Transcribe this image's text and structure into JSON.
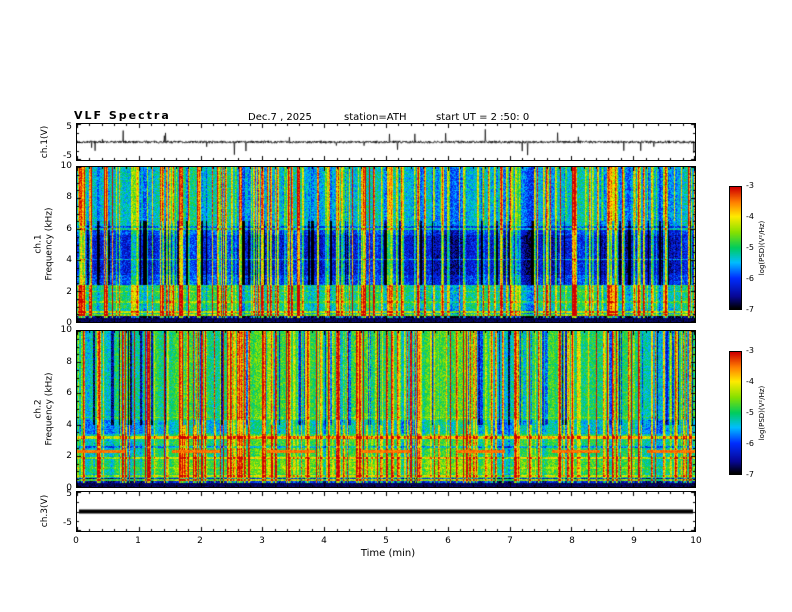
{
  "header": {
    "title": "VLF  Spectra",
    "date": "Dec.7  , 2025",
    "station": "station=ATH",
    "start_ut": "start UT =  2 :50: 0"
  },
  "x_axis": {
    "label": "Time (min)",
    "range": [
      0,
      10
    ],
    "tick_labels": [
      "0",
      "1",
      "2",
      "3",
      "4",
      "5",
      "6",
      "7",
      "8",
      "9",
      "10"
    ]
  },
  "chart_data": [
    {
      "type": "line",
      "name": "ch.1 voltage waveform",
      "ylabel": "ch.1(V)",
      "ylim": [
        -5,
        5
      ],
      "ytick_labels": [
        "5",
        "-5"
      ],
      "xlim": [
        0,
        10
      ],
      "summary": "Noisy broadband trace hovering near 0 V for 10 minutes with frequent impulsive sferic spikes reaching roughly +/-4 V.",
      "render": {
        "seed": 7,
        "noise_amp": 0.38,
        "spike_rate": 0.018,
        "spike_amp": 2.8
      }
    },
    {
      "type": "heatmap",
      "name": "ch.1 spectrogram",
      "channel": "ch.1",
      "ylabel": "Frequency (kHz)",
      "ylim": [
        0,
        10
      ],
      "ytick_labels": [
        "10",
        "8",
        "6",
        "4",
        "2",
        "0"
      ],
      "xlim": [
        0,
        10
      ],
      "colorbar": {
        "label": "log(PSD)(V²/Hz)",
        "tick_labels": [
          "-3",
          "-4",
          "-5",
          "-6",
          "-7"
        ],
        "vmin": -7,
        "vmax": -3
      },
      "summary": "Dense vertical sferic streaks over a green/cyan background; darker blue band near 3-6 kHz; bright yellow horizontal lines below 2.5 kHz; black band at 0-0.25 kHz.",
      "render": {
        "seed": 11,
        "base": -5.15,
        "noise": 0.85,
        "streak_density": 0.33,
        "dark_density": 0.1,
        "bands": [
          [
            0.25,
            0.5,
            -6.6
          ],
          [
            0.8,
            2.4,
            -5.0
          ],
          [
            2.4,
            6.2,
            -5.9
          ],
          [
            3.0,
            5.6,
            -6.15
          ],
          [
            6.2,
            10,
            -5.3
          ]
        ],
        "lines": [
          [
            0.4,
            0.06,
            -4.4
          ],
          [
            0.62,
            0.07,
            -4.1
          ],
          [
            1.25,
            0.05,
            -4.5
          ],
          [
            1.95,
            0.05,
            -4.6
          ],
          [
            2.25,
            0.04,
            -4.8
          ],
          [
            4.05,
            0.04,
            -5.4
          ],
          [
            6.0,
            0.04,
            -5.05
          ]
        ],
        "dark_band": [
          2.4,
          6.5
        ],
        "dash": null
      }
    },
    {
      "type": "heatmap",
      "name": "ch.2 spectrogram",
      "channel": "ch.2",
      "ylabel": "Frequency (kHz)",
      "ylim": [
        0,
        10
      ],
      "ytick_labels": [
        "10",
        "8",
        "6",
        "4",
        "2",
        "0"
      ],
      "xlim": [
        0,
        10
      ],
      "colorbar": {
        "label": "log(PSD)(V²/Hz)",
        "tick_labels": [
          "-3",
          "-4",
          "-5",
          "-6",
          "-7"
        ],
        "vmin": -7,
        "vmax": -3
      },
      "summary": "Greener overall background with vertical sferic streaks and dark-blue streaks above 4 kHz; strong continuous yellow line near 3.2 kHz; dashed red-dark segments near 2.2 kHz; black band at 0-0.25 kHz.",
      "render": {
        "seed": 29,
        "base": -4.95,
        "noise": 0.8,
        "streak_density": 0.3,
        "dark_density": 0.14,
        "bands": [
          [
            0.25,
            0.55,
            -6.3
          ],
          [
            0.8,
            1.7,
            -4.75
          ],
          [
            3.4,
            4.3,
            -5.35
          ],
          [
            4.3,
            10,
            -4.95
          ]
        ],
        "lines": [
          [
            0.4,
            0.06,
            -4.5
          ],
          [
            0.7,
            0.07,
            -4.2
          ],
          [
            1.2,
            0.05,
            -4.45
          ],
          [
            1.85,
            0.06,
            -4.1
          ],
          [
            2.55,
            0.04,
            -5.6
          ],
          [
            3.15,
            0.09,
            -3.85
          ],
          [
            4.45,
            0.05,
            -4.6
          ]
        ],
        "dark_band": [
          4.0,
          10
        ],
        "dash": [
          2.15,
          2.38,
          95,
          48,
          -3.45
        ]
      }
    },
    {
      "type": "line",
      "name": "ch.3 voltage waveform",
      "ylabel": "ch.3(V)",
      "ylim": [
        -5,
        5
      ],
      "ytick_labels": [
        "5",
        "-5"
      ],
      "xlim": [
        0,
        10
      ],
      "summary": "Completely flat thick black trace at about 0 V for the full 10 minutes (dead/saturated channel).",
      "render": {
        "flat_value": 0,
        "thickness": 4,
        "seed": 3
      }
    }
  ]
}
